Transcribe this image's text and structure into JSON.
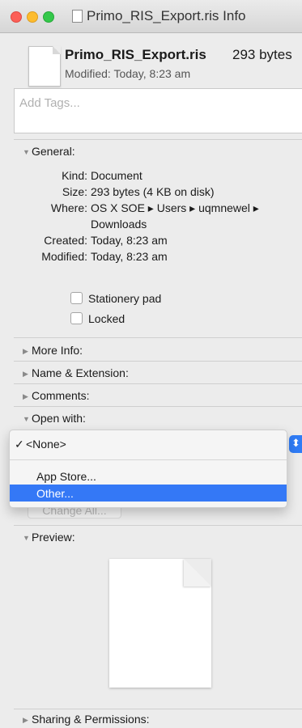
{
  "window": {
    "title": "Primo_RIS_Export.ris Info"
  },
  "header": {
    "filename": "Primo_RIS_Export.ris",
    "size": "293 bytes",
    "modified": "Modified: Today, 8:23 am"
  },
  "tags": {
    "placeholder": "Add Tags..."
  },
  "general": {
    "heading": "General:",
    "rows": [
      {
        "label": "Kind:",
        "value": "Document"
      },
      {
        "label": "Size:",
        "value": "293 bytes (4 KB on disk)"
      },
      {
        "label": "Where:",
        "value": "OS X SOE ▸ Users ▸ uqmnewel ▸"
      },
      {
        "label": "",
        "value": "Downloads"
      },
      {
        "label": "Created:",
        "value": "Today, 8:23 am"
      },
      {
        "label": "Modified:",
        "value": "Today, 8:23 am"
      }
    ],
    "stationery_label": "Stationery pad",
    "locked_label": "Locked"
  },
  "sections": {
    "more_info": "More Info:",
    "name_extension": "Name & Extension:",
    "comments": "Comments:",
    "open_with": "Open with:",
    "preview": "Preview:",
    "sharing": "Sharing & Permissions:"
  },
  "open_with_menu": {
    "selected": "<None>",
    "check": "✓",
    "items": [
      "App Store...",
      "Other..."
    ],
    "highlighted": "Other...",
    "change_all_label": "Change All..."
  },
  "colors": {
    "highlight": "#3478f6"
  }
}
